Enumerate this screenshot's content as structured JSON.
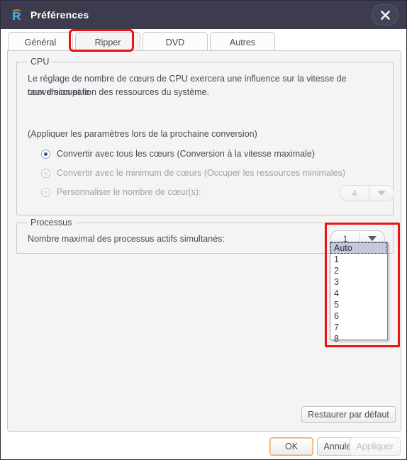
{
  "window": {
    "title": "Préférences",
    "logo_icon": "rip-r-logo-icon",
    "close_icon": "close-icon",
    "titlebar_color": "#3c3c4e",
    "panel_bg": "#f4f4f4",
    "annotation_color": "#ee1111"
  },
  "tabs": [
    {
      "label": "Général",
      "selected": false
    },
    {
      "label": "Ripper",
      "selected": true
    },
    {
      "label": "DVD",
      "selected": false
    },
    {
      "label": "Autres",
      "selected": false
    }
  ],
  "cpu_group": {
    "legend": "CPU",
    "description_line1": "Le réglage de nombre de cœurs de CPU exercera une influence sur la vitesse de conversion et le",
    "description_line2": "taux d'occupation des ressources du système.",
    "apply_note": "(Appliquer les paramètres lors de la prochaine conversion)",
    "options": [
      {
        "label": "Convertir avec tous les cœurs (Conversion à la vitesse maximale)",
        "checked": true,
        "disabled": false
      },
      {
        "label": "Convertir avec le minimum de cœurs (Occuper les ressources minimales)",
        "checked": false,
        "disabled": true
      },
      {
        "label": "Personnaliser le nombre de cœur(s):",
        "checked": false,
        "disabled": true
      }
    ],
    "cores_combo": {
      "value": "4",
      "disabled": true,
      "arrow_icon": "chevron-down-icon"
    }
  },
  "process_group": {
    "legend": "Processus",
    "label": "Nombre maximal des processus actifs simultanés:",
    "combo": {
      "value": "1",
      "arrow_icon": "chevron-down-icon"
    },
    "dropdown": {
      "open": true,
      "highlighted": "Auto",
      "options": [
        "Auto",
        "1",
        "2",
        "3",
        "4",
        "5",
        "6",
        "7",
        "8"
      ]
    }
  },
  "buttons": {
    "restore_defaults": "Restaurer par défaut",
    "ok": "OK",
    "cancel": "Annuler",
    "apply": "Appliquer",
    "apply_disabled": true
  }
}
